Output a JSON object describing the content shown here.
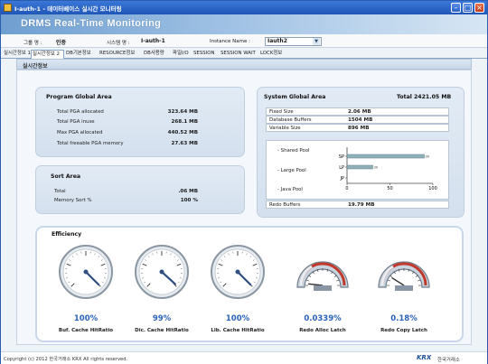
{
  "window": {
    "title": "I-auth-1 - 데이터베이스 실시간 모니터링"
  },
  "app": {
    "banner_title": "DRMS Real-Time Monitoring"
  },
  "filters": {
    "group_label": "그룹 명 :",
    "group_value": "인증",
    "system_label": "시스템 명 :",
    "system_value": "I-auth-1",
    "instance_label": "Instance Name :",
    "instance_value": "Iauth2"
  },
  "tabs": [
    "실시간정보 1",
    "실시간정보 2",
    "DB기본정보",
    "RESOURCE정보",
    "DB사용량",
    "파일I/O",
    "SESSION",
    "SESSION WAIT",
    "LOCK정보"
  ],
  "active_tab_index": 1,
  "section_title": "실시간정보",
  "pga": {
    "title": "Program Global Area",
    "rows": [
      {
        "label": "Total PGA allocated",
        "value": "323.64 MB"
      },
      {
        "label": "Total PGA inuse",
        "value": "268.1 MB"
      },
      {
        "label": "Max PGA allocated",
        "value": "440.52 MB"
      },
      {
        "label": "Total freeable PGA memory",
        "value": "27.63 MB"
      }
    ]
  },
  "sort": {
    "title": "Sort Area",
    "rows": [
      {
        "label": "Total",
        "value": ".06 MB"
      },
      {
        "label": "Memory Sort %",
        "value": "100 %"
      }
    ]
  },
  "sga": {
    "title": "System Global Area",
    "total_label": "Total",
    "total_value": "2421.05 MB",
    "rows": [
      {
        "label": "Fixed Size",
        "value": "2.06 MB"
      },
      {
        "label": "Database Buffers",
        "value": "1504 MB"
      },
      {
        "label": "Variable Size",
        "value": "896 MB"
      }
    ],
    "pool_labels": [
      "- Shared Pool",
      "- Large Pool",
      "- Java Pool"
    ],
    "redo_label": "Redo Buffers",
    "redo_value": "19.79 MB"
  },
  "chart_data": {
    "type": "bar",
    "orientation": "horizontal",
    "categories": [
      "SP",
      "LP",
      "JP"
    ],
    "values": [
      90,
      30,
      0
    ],
    "data_labels": [
      "90",
      "30",
      "0"
    ],
    "xlim": [
      0,
      100
    ],
    "xticks": [
      "0",
      "50",
      "100"
    ],
    "colors": {
      "bar": "#8fb0b8",
      "bar_edge": "#5e7f88"
    }
  },
  "efficiency": {
    "title": "Efficiency",
    "gauges": [
      {
        "name": "buf-cache-hitratio",
        "value": "100%",
        "label": "Buf. Cache HitRatio",
        "style": "round",
        "level": 1.0
      },
      {
        "name": "dic-cache-hitratio",
        "value": "99%",
        "label": "Dic. Cache HitRatio",
        "style": "round",
        "level": 0.99
      },
      {
        "name": "lib-cache-hitratio",
        "value": "100%",
        "label": "Lib. Cache HitRatio",
        "style": "round",
        "level": 1.0
      },
      {
        "name": "redo-alloc-latch",
        "value": "0.0339%",
        "label": "Redo Alloc Latch",
        "style": "arc",
        "level": 0.000339
      },
      {
        "name": "redo-copy-latch",
        "value": "0.18%",
        "label": "Redo Copy Latch",
        "style": "arc",
        "level": 0.0018
      }
    ]
  },
  "footer": {
    "copyright": "Copyright (c) 2012 한국거래소 KRX All rights reserved.",
    "logo": "KRX",
    "org": "한국거래소"
  },
  "colors": {
    "accent": "#2a63b8",
    "banner": "#6f9fd0",
    "gauge_red": "#c0392b"
  }
}
